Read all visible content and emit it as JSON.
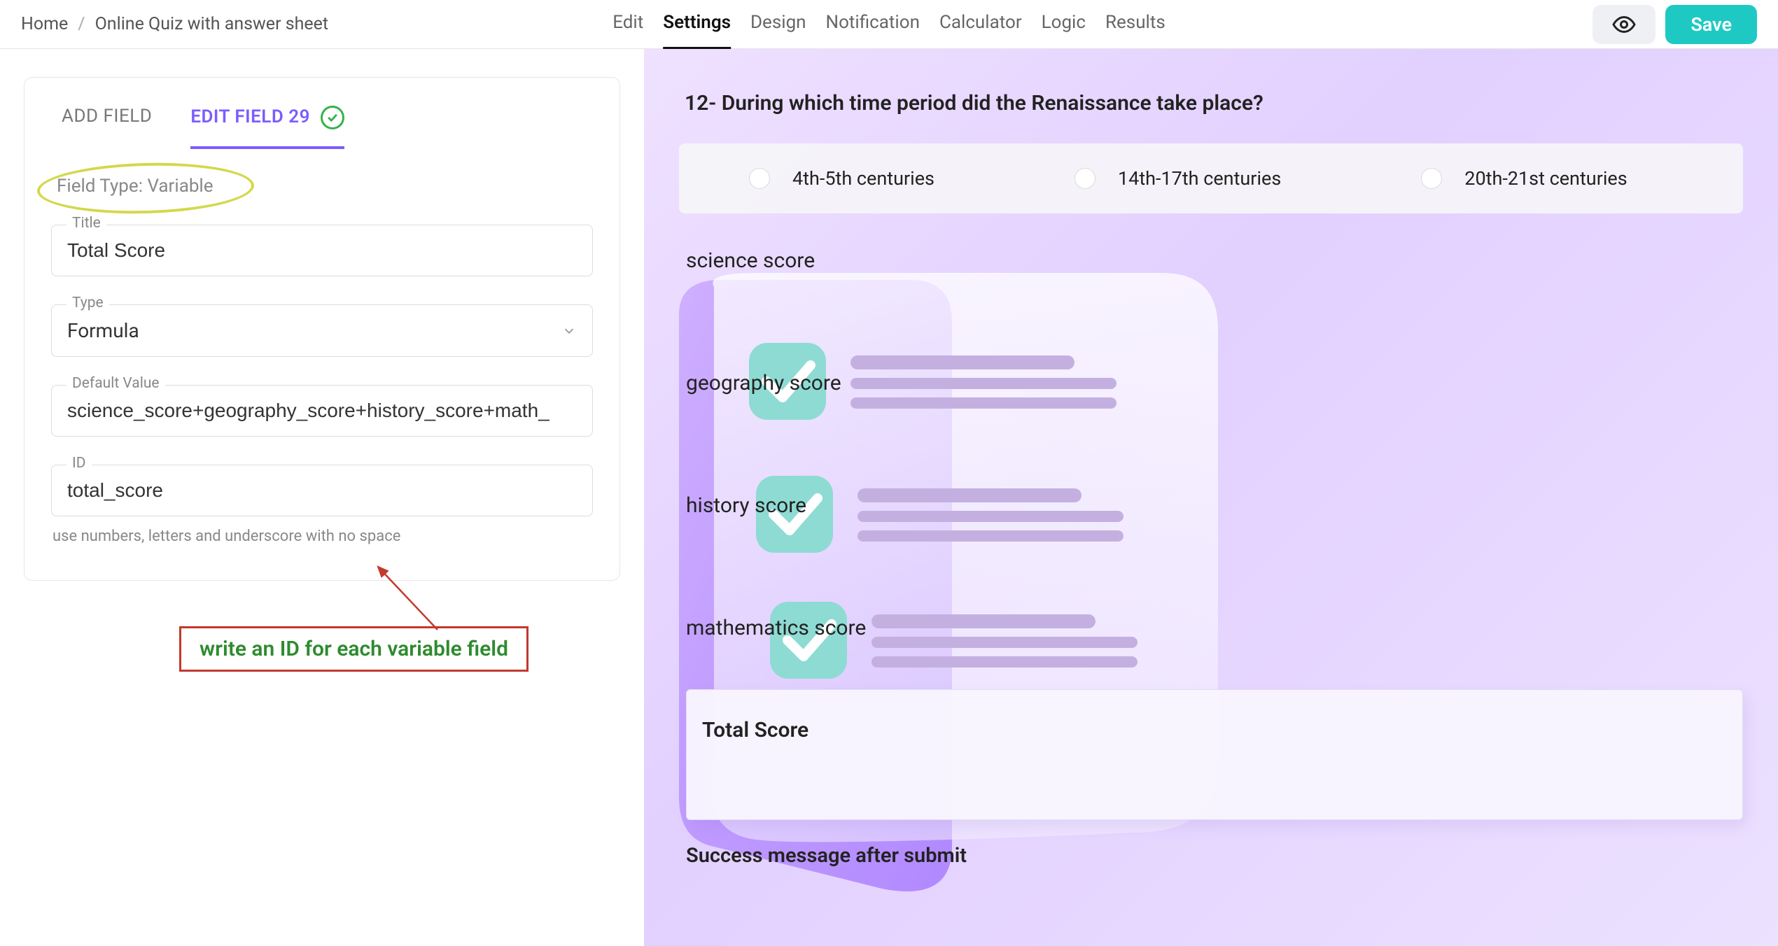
{
  "breadcrumb": {
    "home": "Home",
    "current": "Online Quiz with answer sheet"
  },
  "nav": {
    "edit": "Edit",
    "settings": "Settings",
    "design": "Design",
    "notification": "Notification",
    "calculator": "Calculator",
    "logic": "Logic",
    "results": "Results"
  },
  "buttons": {
    "save": "Save"
  },
  "panel": {
    "tab_add": "ADD FIELD",
    "tab_edit": "EDIT FIELD 29",
    "field_type_label": "Field Type: Variable",
    "title_label": "Title",
    "title_value": "Total Score",
    "type_label": "Type",
    "type_value": "Formula",
    "default_label": "Default Value",
    "default_value": "science_score+geography_score+history_score+math_",
    "id_label": "ID",
    "id_value": "total_score",
    "id_help": "use numbers, letters and underscore with no space"
  },
  "annotation": {
    "text": "write an ID for each variable field"
  },
  "preview": {
    "question": "12- During which time period did the Renaissance take place?",
    "opt1": "4th-5th centuries",
    "opt2": "14th-17th centuries",
    "opt3": "20th-21st centuries",
    "score_science": "science score",
    "score_geography": "geography score",
    "score_history": "history score",
    "score_math": "mathematics score",
    "total": "Total Score",
    "success_msg": "Success message after submit"
  }
}
